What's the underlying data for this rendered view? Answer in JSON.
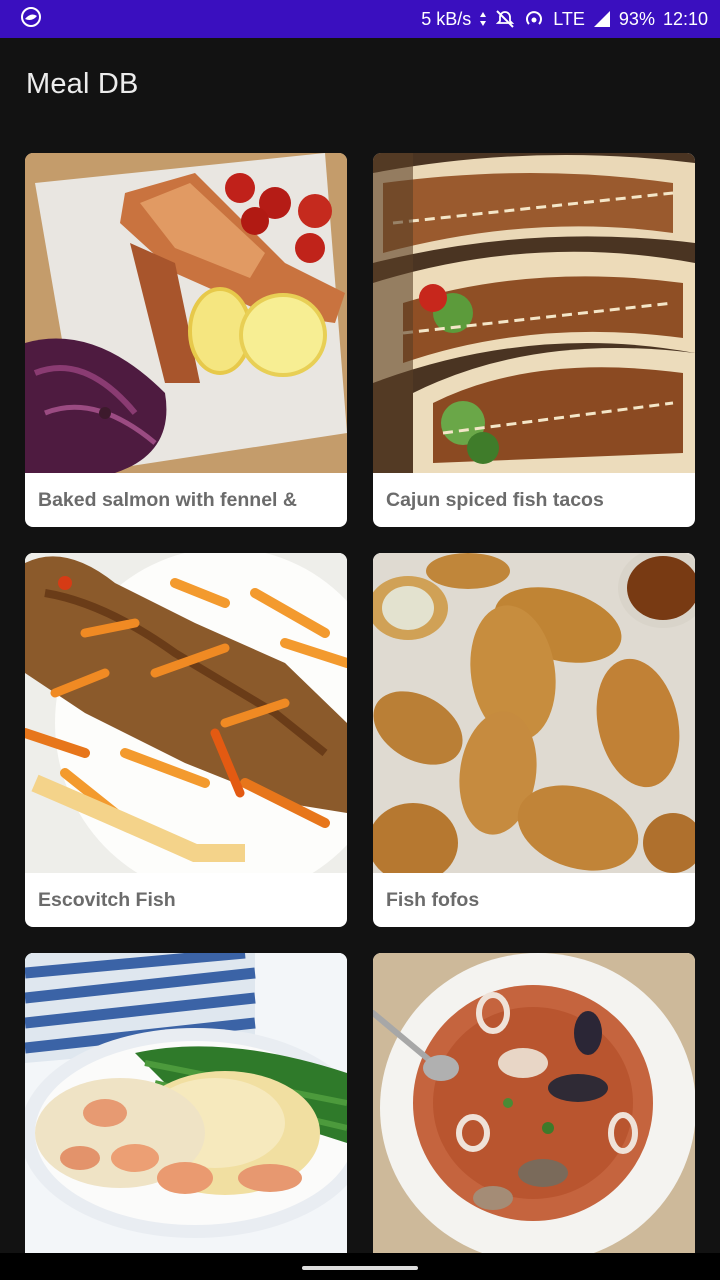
{
  "status_bar": {
    "net_speed": "5 kB/s",
    "network": "LTE",
    "battery": "93%",
    "time": "12:10"
  },
  "app": {
    "title": "Meal DB"
  },
  "meals": [
    {
      "name": "Baked salmon with fennel &"
    },
    {
      "name": "Cajun spiced fish tacos"
    },
    {
      "name": "Escovitch Fish"
    },
    {
      "name": "Fish fofos"
    },
    {
      "name": ""
    },
    {
      "name": ""
    }
  ]
}
